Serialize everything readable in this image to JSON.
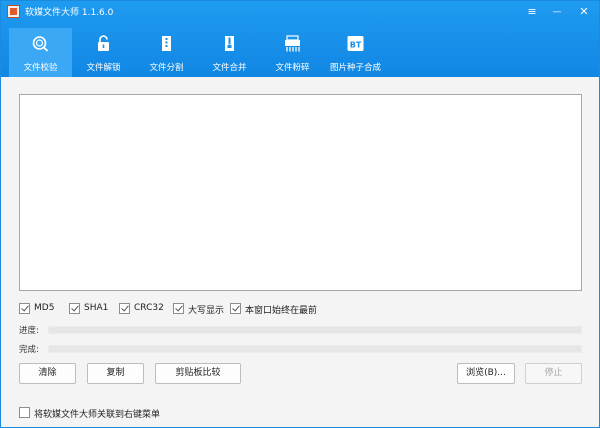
{
  "window": {
    "title": "软媒文件大师 1.1.6.0"
  },
  "window_controls": {
    "menu": "≡",
    "minimize": "—",
    "close": "✕"
  },
  "tabs": [
    {
      "label": "文件校验",
      "icon": "search-document-icon",
      "active": true
    },
    {
      "label": "文件解锁",
      "icon": "unlock-icon",
      "active": false
    },
    {
      "label": "文件分割",
      "icon": "file-split-icon",
      "active": false
    },
    {
      "label": "文件合并",
      "icon": "file-merge-icon",
      "active": false
    },
    {
      "label": "文件粉碎",
      "icon": "shredder-icon",
      "active": false
    },
    {
      "label": "图片种子合成",
      "icon": "bt-icon",
      "active": false
    }
  ],
  "output_text": "",
  "options": [
    {
      "label": "MD5",
      "checked": true
    },
    {
      "label": "SHA1",
      "checked": true
    },
    {
      "label": "CRC32",
      "checked": true
    },
    {
      "label": "大写显示",
      "checked": true
    },
    {
      "label": "本窗口始终在最前",
      "checked": true
    }
  ],
  "progress": {
    "label": "进度:",
    "value": 0
  },
  "complete": {
    "label": "完成:",
    "value": 0
  },
  "buttons": {
    "clear": "清除",
    "copy": "复制",
    "clipboard_compare": "剪贴板比较",
    "browse": "浏览(B)...",
    "stop": "停止"
  },
  "context_menu_option": {
    "label": "将软媒文件大师关联到右键菜单",
    "checked": false
  },
  "colors": {
    "header": "#1187e4",
    "active_tab": "#3aa8f4"
  }
}
